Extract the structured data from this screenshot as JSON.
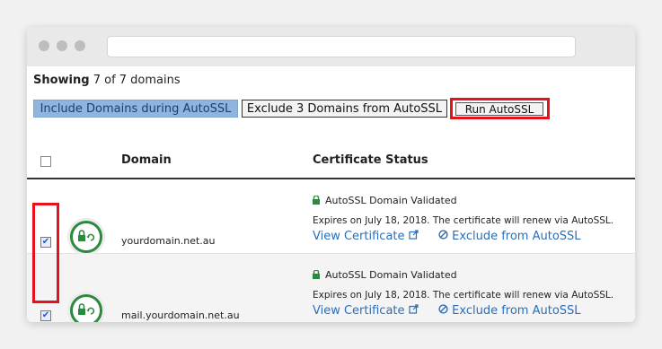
{
  "showing": {
    "prefix": "Showing",
    "rest": " 7 of 7 domains"
  },
  "buttons": {
    "include": "Include Domains during AutoSSL",
    "exclude": "Exclude 3 Domains from AutoSSL",
    "run": "Run AutoSSL"
  },
  "table": {
    "headers": {
      "domain": "Domain",
      "status": "Certificate Status"
    },
    "rows": [
      {
        "domain": "yourdomain.net.au",
        "status": "AutoSSL Domain Validated",
        "expires": "Expires on July 18, 2018. The certificate will renew via AutoSSL.",
        "view_link": "View Certificate",
        "exclude_link": "Exclude from AutoSSL",
        "checked": true
      },
      {
        "domain": "mail.yourdomain.net.au",
        "status": "AutoSSL Domain Validated",
        "expires": "Expires on July 18, 2018. The certificate will renew via AutoSSL.",
        "view_link": "View Certificate",
        "exclude_link": "Exclude from AutoSSL",
        "checked": true
      }
    ]
  },
  "icons": {
    "lock": "lock-icon",
    "external": "external-link-icon",
    "ban": "ban-icon",
    "checkmark": "✔"
  },
  "colors": {
    "include_button_bg": "#8fb5df",
    "highlight_red": "#e8101c",
    "lock_green": "#2a8a3e",
    "link_blue": "#2a6ebb"
  }
}
